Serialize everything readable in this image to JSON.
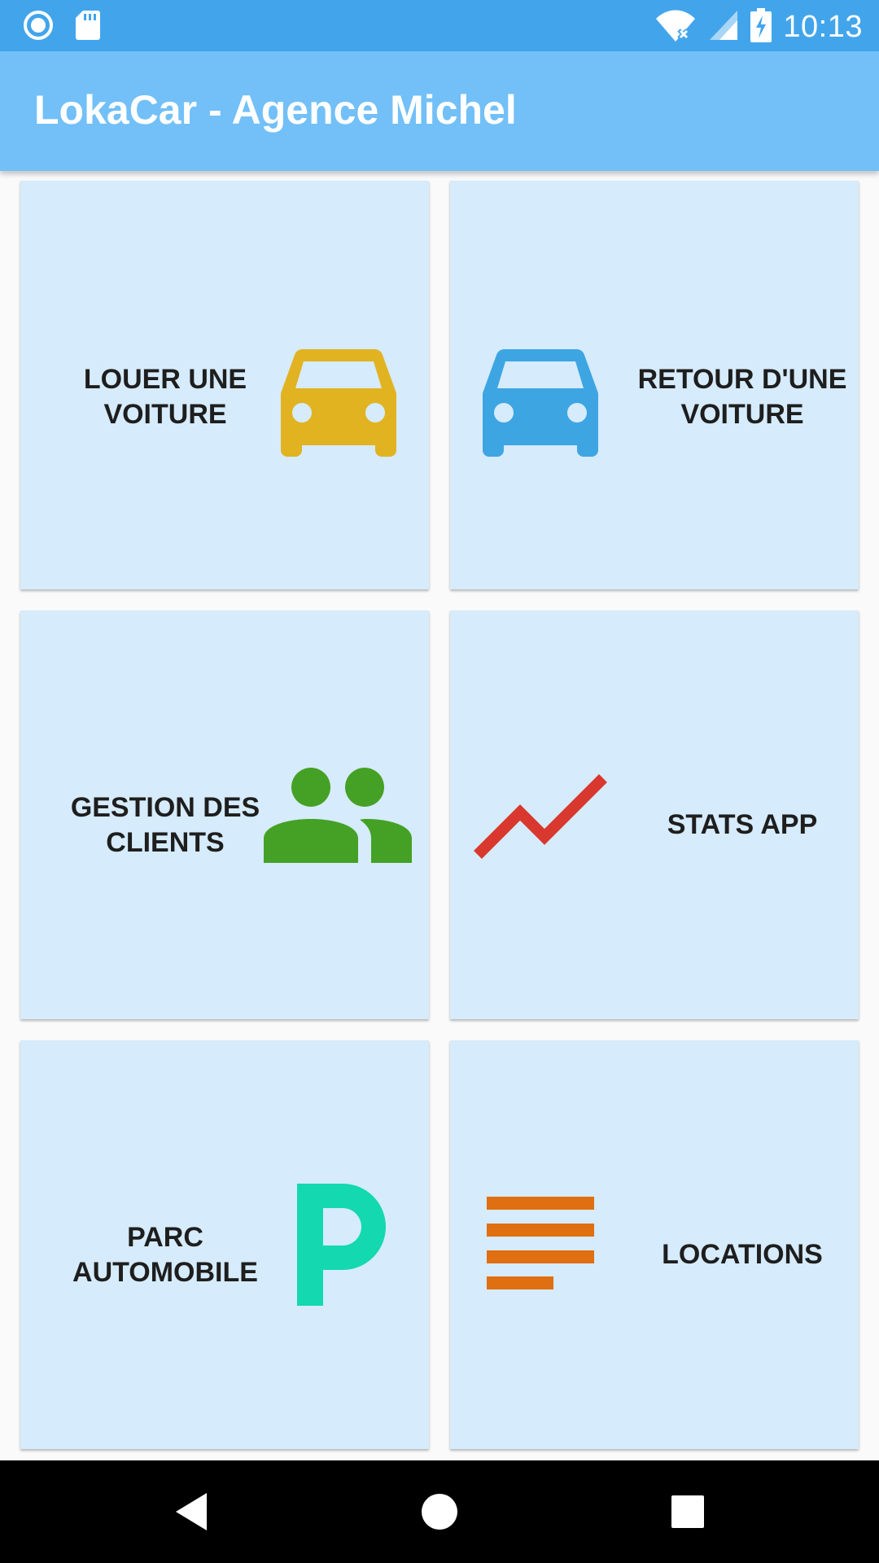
{
  "status_bar": {
    "time": "10:13",
    "icons": [
      "record-icon",
      "sd-card-icon",
      "wifi-no-internet-icon",
      "signal-icon",
      "battery-charging-icon"
    ]
  },
  "app_bar": {
    "title": "LokaCar - Agence Michel"
  },
  "tiles": [
    {
      "label": "LOUER UNE\nVOITURE",
      "icon": "car-icon",
      "color": "#e2b321"
    },
    {
      "label": "RETOUR D'UNE\nVOITURE",
      "icon": "car-icon",
      "color": "#3ea5e3"
    },
    {
      "label": "GESTION DES\nCLIENTS",
      "icon": "people-icon",
      "color": "#45a125"
    },
    {
      "label": "STATS APP",
      "icon": "trending-up-icon",
      "color": "#d9382e"
    },
    {
      "label": "PARC\nAUTOMOBILE",
      "icon": "parking-icon",
      "color": "#13d8b0"
    },
    {
      "label": "LOCATIONS",
      "icon": "list-lines-icon",
      "color": "#df6f10"
    }
  ],
  "nav_bar": {
    "buttons": [
      "back-icon",
      "home-icon",
      "recents-icon"
    ]
  },
  "colors": {
    "status_bar": "#42a5ec",
    "app_bar": "#72c0f7",
    "tile_background": "#d6ebfb"
  }
}
